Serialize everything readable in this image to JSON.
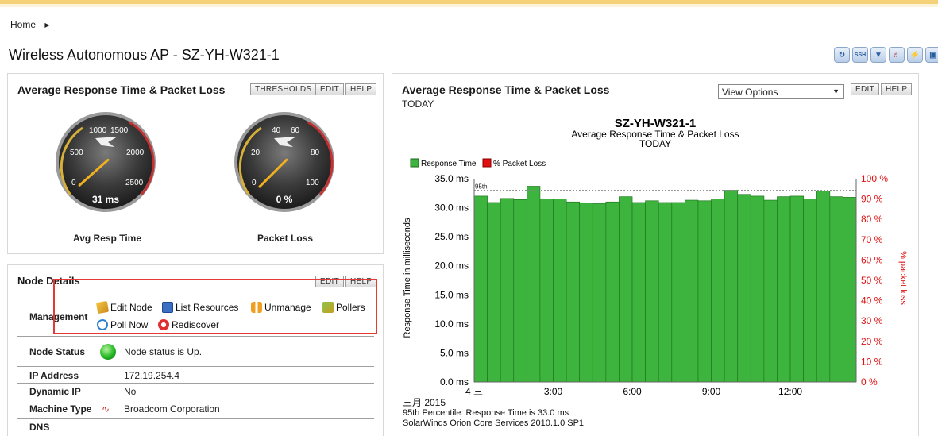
{
  "breadcrumb": {
    "home": "Home"
  },
  "page": {
    "title": "Wireless Autonomous AP - SZ-YH-W321-1"
  },
  "toolbar": {
    "icons": [
      "refresh-icon",
      "ssh-icon",
      "telnet-icon",
      "sound-icon",
      "poll-icon",
      "remote-desktop-icon"
    ]
  },
  "gauges_panel": {
    "title": "Average Response Time & Packet Loss",
    "buttons": {
      "thresholds": "THRESHOLDS",
      "edit": "EDIT",
      "help": "HELP"
    },
    "gauge1": {
      "label": "Avg Resp Time",
      "value_text": "31 ms",
      "value": 31,
      "max": 2500,
      "ticks": [
        "0",
        "500",
        "1000",
        "1500",
        "2000",
        "2500"
      ]
    },
    "gauge2": {
      "label": "Packet Loss",
      "value_text": "0 %",
      "value": 0,
      "max": 100,
      "ticks": [
        "0",
        "20",
        "40",
        "60",
        "80",
        "100"
      ]
    }
  },
  "node_details": {
    "title": "Node Details",
    "buttons": {
      "edit": "EDIT",
      "help": "HELP"
    },
    "management_label": "Management",
    "links": {
      "edit_node": "Edit Node",
      "list_resources": "List Resources",
      "unmanage": "Unmanage",
      "pollers": "Pollers",
      "poll_now": "Poll Now",
      "rediscover": "Rediscover"
    },
    "rows": {
      "node_status": {
        "k": "Node Status",
        "v": "Node status is Up."
      },
      "ip_address": {
        "k": "IP Address",
        "v": "172.19.254.4"
      },
      "dynamic_ip": {
        "k": "Dynamic IP",
        "v": "No"
      },
      "machine_type": {
        "k": "Machine Type",
        "v": "Broadcom Corporation"
      },
      "dns": {
        "k": "DNS",
        "v": ""
      }
    }
  },
  "chart_panel": {
    "title": "Average Response Time & Packet Loss",
    "subtitle": "TODAY",
    "view_options": "View Options",
    "buttons": {
      "edit": "EDIT",
      "help": "HELP"
    },
    "footer": {
      "date": "三月 2015",
      "percentile": "95th Percentile: Response Time is 33.0  ms",
      "product": "SolarWinds Orion Core Services 2010.1.0 SP1"
    }
  },
  "colors": {
    "bar_green": "#3db43d",
    "loss_red": "#e01010",
    "gauge_needle": "#f0b020"
  },
  "chart_data": {
    "type": "bar",
    "title": "SZ-YH-W321-1",
    "subtitle": "Average Response Time & Packet Loss",
    "subtitle2": "TODAY",
    "legend": [
      "Response Time",
      "% Packet Loss"
    ],
    "legend_placement": "top-left",
    "ylabel": "Response Time in milliseconds",
    "y2label": "% packet loss",
    "ylim": [
      0,
      35
    ],
    "y2lim": [
      0,
      100
    ],
    "yticks": [
      "0.0 ms",
      "5.0 ms",
      "10.0 ms",
      "15.0 ms",
      "20.0 ms",
      "25.0 ms",
      "30.0 ms",
      "35.0 ms"
    ],
    "y2ticks": [
      "0 %",
      "10 %",
      "20 %",
      "30 %",
      "40 %",
      "50 %",
      "60 %",
      "70 %",
      "80 %",
      "90 %",
      "100 %"
    ],
    "xticks": [
      "4 三",
      "3:00",
      "6:00",
      "9:00",
      "12:00"
    ],
    "percentile_label": "95th",
    "percentile_value": 33.0,
    "series": [
      {
        "name": "Response Time",
        "values": [
          32.0,
          30.9,
          31.6,
          31.4,
          33.7,
          31.5,
          31.5,
          31.0,
          30.8,
          30.7,
          31.0,
          31.9,
          30.9,
          31.2,
          30.9,
          30.9,
          31.3,
          31.2,
          31.5,
          33.0,
          32.3,
          32.0,
          31.3,
          31.9,
          32.0,
          31.5,
          32.9,
          31.9,
          31.8
        ]
      },
      {
        "name": "% Packet Loss",
        "values": [
          0,
          0,
          0,
          0,
          0,
          0,
          0,
          0,
          0,
          0,
          0,
          0,
          0,
          0,
          0,
          0,
          0,
          0,
          0,
          0,
          0,
          0,
          0,
          0,
          0,
          0,
          0,
          0,
          0
        ]
      }
    ]
  }
}
